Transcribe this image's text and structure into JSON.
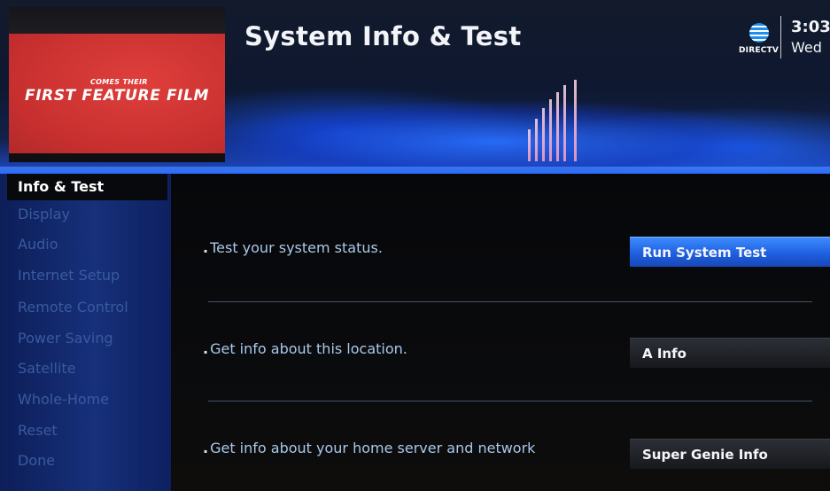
{
  "header": {
    "title": "System Info & Test",
    "brand_label": "DIRECTV",
    "clock_time": "3:03",
    "clock_day": "Wed"
  },
  "preview": {
    "subtitle": "COMES THEIR",
    "title": "FIRST FEATURE FILM"
  },
  "sidebar": {
    "items": [
      {
        "label": "Info & Test",
        "selected": true
      },
      {
        "label": "Display"
      },
      {
        "label": "Audio"
      },
      {
        "label": "Internet Setup"
      },
      {
        "label": "Remote Control"
      },
      {
        "label": "Power Saving"
      },
      {
        "label": "Satellite"
      },
      {
        "label": "Whole-Home"
      },
      {
        "label": "Reset"
      },
      {
        "label": "Done"
      }
    ]
  },
  "main": {
    "rows": [
      {
        "bullet": ".",
        "text": "Test your system status.",
        "button": "Run System Test",
        "focused": true
      },
      {
        "bullet": ".",
        "text": "Get info about this location.",
        "button": "A Info"
      },
      {
        "bullet": ".",
        "text": "Get info about your home server and network",
        "button": "Super Genie Info"
      }
    ]
  },
  "colors": {
    "accent_blue": "#2f6fff",
    "sidebar_bg": "#16307a",
    "inactive_text": "#3a5a9e",
    "row_text": "#a9c8ea",
    "preview_red": "#d23a38"
  }
}
